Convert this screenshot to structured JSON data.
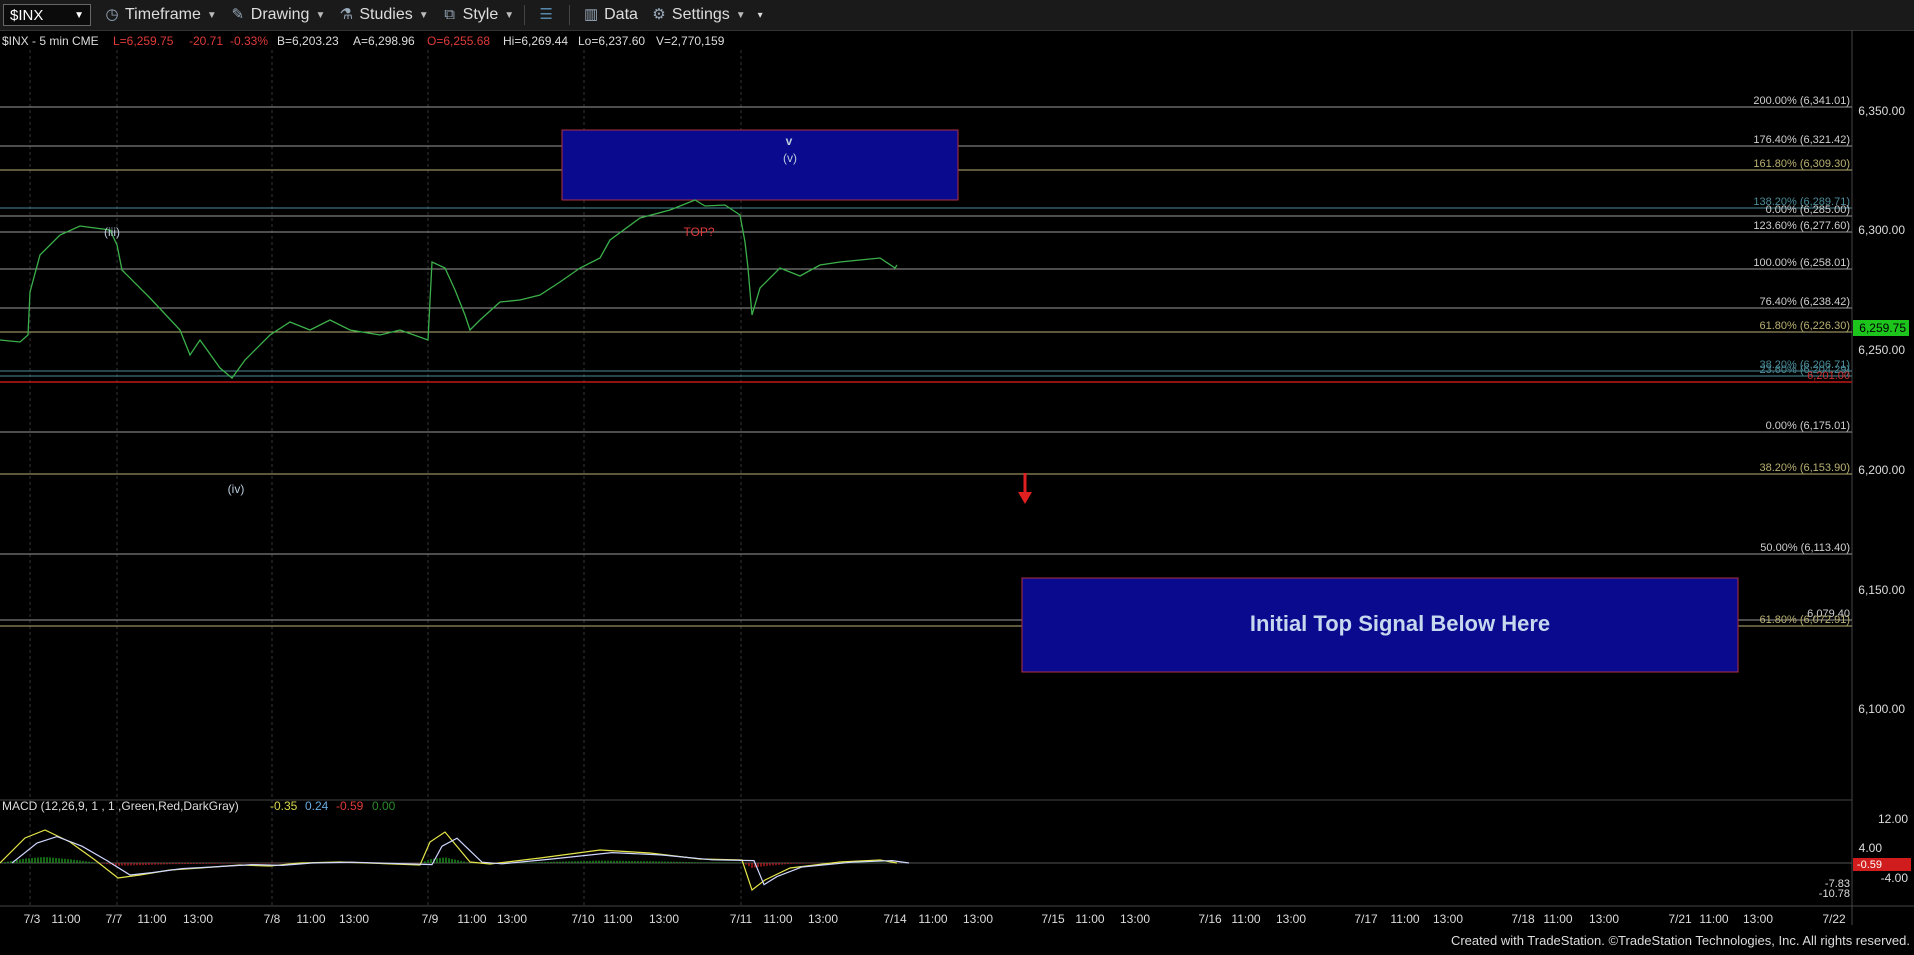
{
  "toolbar": {
    "symbol": "$INX",
    "timeframe": "Timeframe",
    "drawing": "Drawing",
    "studies": "Studies",
    "style": "Style",
    "data": "Data",
    "settings": "Settings"
  },
  "header": {
    "symbol_line": "$INX - 5 min  CME",
    "last": "L=6,259.75",
    "change": "-20.71",
    "change_pct": "-0.33%",
    "bid": "B=6,203.23",
    "ask": "A=6,298.96",
    "open": "O=6,255.68",
    "high": "Hi=6,269.44",
    "low": "Lo=6,237.60",
    "volume": "V=2,770,159"
  },
  "price_axis": {
    "ticks": [
      "6,350.00",
      "6,300.00",
      "6,250.00",
      "6,200.00",
      "6,150.00",
      "6,100.00"
    ],
    "last_price_tag": "6,259.75"
  },
  "fib_levels": [
    {
      "label": "200.00% (6,341.01)",
      "color": "#cfcfcf"
    },
    {
      "label": "176.40% (6,321.42)",
      "color": "#cfcfcf"
    },
    {
      "label": "161.80% (6,309.30)",
      "color": "#b9b072"
    },
    {
      "label": "138.20% (6,289.71)",
      "color": "#4a8c99"
    },
    {
      "label": "0.00% (6,285.00)",
      "color": "#cfcfcf"
    },
    {
      "label": "123.60% (6,277.60)",
      "color": "#cfcfcf"
    },
    {
      "label": "100.00% (6,258.01)",
      "color": "#cfcfcf"
    },
    {
      "label": "76.40% (6,238.42)",
      "color": "#cfcfcf"
    },
    {
      "label": "61.80% (6,226.30)",
      "color": "#b9b072"
    },
    {
      "label": "38.20% (6,206.71)",
      "color": "#4a8c99"
    },
    {
      "label": "23.60% (6,204.29)",
      "color": "#4a8c99"
    },
    {
      "label": "6,201.00",
      "color": "#d03030"
    },
    {
      "label": "0.00% (6,175.01)",
      "color": "#cfcfcf"
    },
    {
      "label": "38.20% (6,153.90)",
      "color": "#b9b072"
    },
    {
      "label": "50.00% (6,113.40)",
      "color": "#cfcfcf"
    },
    {
      "label": "6,079.40",
      "color": "#cfcfcf"
    },
    {
      "label": "61.80% (6,072.91)",
      "color": "#b9b072"
    }
  ],
  "annotations": {
    "wave_iii": "(iii)",
    "wave_iv": "(iv)",
    "wave_v_upper": "v",
    "wave_v_lower": "(v)",
    "top": "TOP?",
    "box_text": "Initial Top Signal Below Here"
  },
  "macd": {
    "label": "MACD (12,26,9, 1 , 1 ,Green,Red,DarkGray)",
    "v1": "-0.35",
    "v2": "0.24",
    "v3": "-0.59",
    "v4": "0.00",
    "axis_ticks": [
      "12.00",
      "4.00",
      "-4.00"
    ],
    "tag_red": "-0.59",
    "tag_low1": "-7.83",
    "tag_low2": "-10.78"
  },
  "time_axis": [
    "7/3",
    "11:00",
    "7/7",
    "11:00",
    "13:00",
    "7/8",
    "11:00",
    "13:00",
    "7/9",
    "11:00",
    "13:00",
    "7/10",
    "11:00",
    "13:00",
    "7/11",
    "11:00",
    "13:00",
    "7/14",
    "11:00",
    "13:00",
    "7/15",
    "11:00",
    "13:00",
    "7/16",
    "11:00",
    "13:00",
    "7/17",
    "11:00",
    "13:00",
    "7/18",
    "11:00",
    "13:00",
    "7/21",
    "11:00",
    "13:00",
    "7/22"
  ],
  "footer": "Created with TradeStation. ©TradeStation Technologies, Inc. All rights reserved."
}
